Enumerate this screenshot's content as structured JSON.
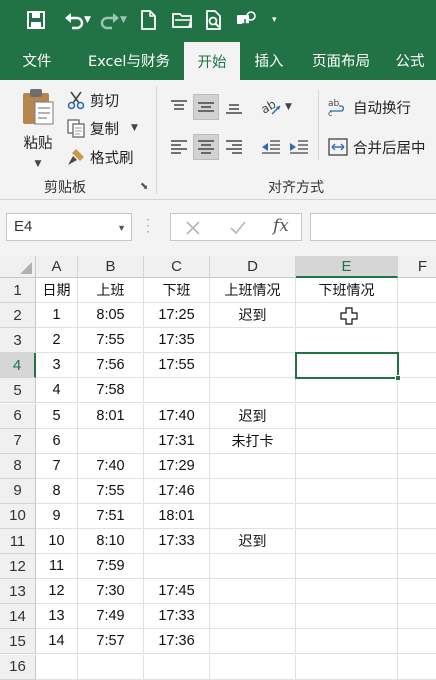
{
  "quick_access": {
    "items": [
      "save-icon",
      "undo-icon",
      "redo-icon",
      "new-file-icon",
      "open-folder-icon",
      "print-preview-icon",
      "touch-mode-icon",
      "customize-dropdown-icon"
    ]
  },
  "tabs": [
    {
      "label": "文件"
    },
    {
      "label": "Excel与财务"
    },
    {
      "label": "开始",
      "active": true
    },
    {
      "label": "插入"
    },
    {
      "label": "页面布局"
    },
    {
      "label": "公式"
    }
  ],
  "ribbon": {
    "clipboard": {
      "paste": "粘贴",
      "cut": "剪切",
      "copy": "复制",
      "format_painter": "格式刷",
      "group_label": "剪贴板"
    },
    "alignment": {
      "wrap_text": "自动换行",
      "merge_center": "合并后居中",
      "group_label": "对齐方式"
    }
  },
  "formula_bar": {
    "name_box": "E4",
    "formula": ""
  },
  "sheet": {
    "columns": [
      "A",
      "B",
      "C",
      "D",
      "E",
      "F"
    ],
    "selected_column": "E",
    "selected_row": 4,
    "active_cell": "E4",
    "rows": [
      {
        "n": "1",
        "cells": [
          "日期",
          "上班",
          "下班",
          "上班情况",
          "下班情况"
        ]
      },
      {
        "n": "2",
        "cells": [
          "1",
          "8:05",
          "17:25",
          "迟到",
          ""
        ]
      },
      {
        "n": "3",
        "cells": [
          "2",
          "7:55",
          "17:35",
          "",
          ""
        ]
      },
      {
        "n": "4",
        "cells": [
          "3",
          "7:56",
          "17:55",
          "",
          ""
        ]
      },
      {
        "n": "5",
        "cells": [
          "4",
          "7:58",
          "",
          "",
          ""
        ]
      },
      {
        "n": "6",
        "cells": [
          "5",
          "8:01",
          "17:40",
          "迟到",
          ""
        ]
      },
      {
        "n": "7",
        "cells": [
          "6",
          "",
          "17:31",
          "未打卡",
          ""
        ]
      },
      {
        "n": "8",
        "cells": [
          "7",
          "7:40",
          "17:29",
          "",
          ""
        ]
      },
      {
        "n": "9",
        "cells": [
          "8",
          "7:55",
          "17:46",
          "",
          ""
        ]
      },
      {
        "n": "10",
        "cells": [
          "9",
          "7:51",
          "18:01",
          "",
          ""
        ]
      },
      {
        "n": "11",
        "cells": [
          "10",
          "8:10",
          "17:33",
          "迟到",
          ""
        ]
      },
      {
        "n": "12",
        "cells": [
          "11",
          "7:59",
          "",
          "",
          ""
        ]
      },
      {
        "n": "13",
        "cells": [
          "12",
          "7:30",
          "17:45",
          "",
          ""
        ]
      },
      {
        "n": "14",
        "cells": [
          "13",
          "7:49",
          "17:33",
          "",
          ""
        ]
      },
      {
        "n": "15",
        "cells": [
          "14",
          "7:57",
          "17:36",
          "",
          ""
        ]
      },
      {
        "n": "16",
        "cells": [
          "",
          "",
          "",
          "",
          ""
        ]
      }
    ]
  },
  "colors": {
    "accent": "#217346",
    "ribbon_bg": "#f3f3f3",
    "header_bg": "#f0f0f0",
    "selected_header_bg": "#d6d6d6"
  }
}
